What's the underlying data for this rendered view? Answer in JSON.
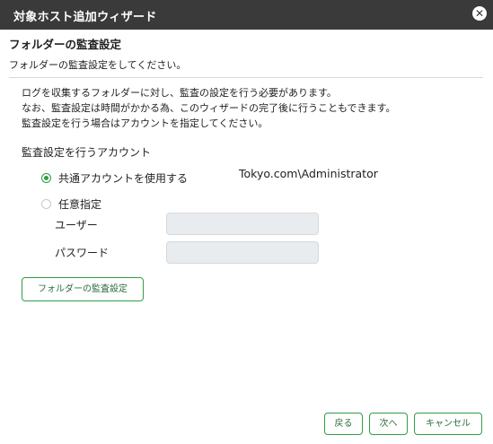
{
  "window": {
    "title": "対象ホスト追加ウィザード",
    "close_icon": "close-icon"
  },
  "page": {
    "heading": "フォルダーの監査設定",
    "subheading": "フォルダーの監査設定をしてください。",
    "description": [
      "ログを収集するフォルダーに対し、監査の設定を行う必要があります。",
      "なお、監査設定は時間がかかる為、このウィザードの完了後に行うこともできます。",
      "監査設定を行う場合はアカウントを指定してください。"
    ]
  },
  "account": {
    "section_label": "監査設定を行うアカウント",
    "options": [
      {
        "label": "共通アカウントを使用する",
        "selected": true
      },
      {
        "label": "任意指定",
        "selected": false
      }
    ],
    "common_account_value": "Tokyo.com\\Administrator",
    "user_label": "ユーザー",
    "user_value": "",
    "password_label": "パスワード",
    "password_value": ""
  },
  "buttons": {
    "folder_audit": "フォルダーの監査設定",
    "back": "戻る",
    "next": "次へ",
    "cancel": "キャンセル"
  },
  "colors": {
    "titlebar": "#3a3a3a",
    "accent_green": "#2f9e44",
    "input_disabled_bg": "#e9ecef"
  }
}
